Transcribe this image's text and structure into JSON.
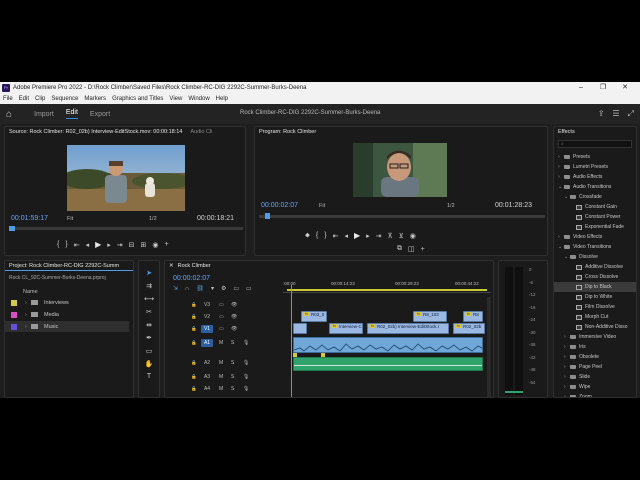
{
  "titlebar": {
    "logo_text": "Pr",
    "title": "Adobe Premiere Pro 2022 - D:\\Rock Climber\\Saved Files\\Rock Climber-RC-DIG 2292C-Summer-Burks-Deena",
    "minimize": "–",
    "restore": "❐",
    "close": "✕"
  },
  "menubar": [
    "File",
    "Edit",
    "Clip",
    "Sequence",
    "Markers",
    "Graphics and Titles",
    "View",
    "Window",
    "Help"
  ],
  "workspaces": {
    "home_icon": "home-icon",
    "items": [
      "Import",
      "Edit",
      "Export"
    ],
    "active": "Edit",
    "project_title": "Rock Climber-RC-DIG 2292C-Summer-Burks-Deena"
  },
  "source": {
    "tab_label": "Source: Rock Climber: R02_02b) Interview-EditStock.mov: 00:00:18:14",
    "tab2": "Audio Cli",
    "timecode_in": "00:01:59:17",
    "timecode_dur": "00:00:18:21",
    "fit": "Fit",
    "resolution": "1/2"
  },
  "program": {
    "tab_label": "Program: Rock Climber",
    "timecode_in": "00:00:02:07",
    "timecode_dur": "00:01:28:23",
    "fit": "Fit",
    "resolution": "1/2"
  },
  "project": {
    "tab_label": "Project: Rock Climber-RC-DIG 2292C-Summ",
    "file_path": "Rock CL_92C-Summer-Burks-Deena.prproj",
    "column_name": "Name",
    "items": [
      {
        "label": "Interviews",
        "color": "#d4c94a"
      },
      {
        "label": "Media",
        "color": "#d64fc4"
      },
      {
        "label": "Music",
        "color": "#6a4fd6"
      }
    ]
  },
  "timeline": {
    "tab_label": "Rock Climber",
    "timecode": "00:00:02:07",
    "ruler": [
      ":00:00",
      "00:00:14:23",
      "00:00:29:23",
      "00:00:44:22"
    ],
    "video_tracks": [
      "V3",
      "V2",
      "V1"
    ],
    "audio_tracks": [
      "A1",
      "A2",
      "A3",
      "A4"
    ],
    "mix_label": "Mix",
    "mix_value": "0.0",
    "clips": {
      "v2_a": "R03_0",
      "v2_b": "R8_103",
      "v2_c": "R8",
      "v1_a": "Interview-C",
      "v1_b": "R02_02b) Interview-EditStock.r",
      "v1_c": "R02_02b"
    }
  },
  "meters": {
    "scale": [
      "0",
      "-6",
      "-12",
      "-18",
      "-24",
      "-30",
      "-36",
      "-42",
      "-48",
      "-54"
    ]
  },
  "effects": {
    "tab_label": "Effects",
    "items": [
      {
        "label": "Presets",
        "level": 0,
        "type": "folder"
      },
      {
        "label": "Lumetri Presets",
        "level": 0,
        "type": "folder"
      },
      {
        "label": "Audio Effects",
        "level": 0,
        "type": "folder"
      },
      {
        "label": "Audio Transitions",
        "level": 0,
        "type": "folder-open"
      },
      {
        "label": "Crossfade",
        "level": 1,
        "type": "folder-open"
      },
      {
        "label": "Constant Gain",
        "level": 2,
        "type": "fx"
      },
      {
        "label": "Constant Power",
        "level": 2,
        "type": "fx"
      },
      {
        "label": "Exponential Fade",
        "level": 2,
        "type": "fx"
      },
      {
        "label": "Video Effects",
        "level": 0,
        "type": "folder"
      },
      {
        "label": "Video Transitions",
        "level": 0,
        "type": "folder-open"
      },
      {
        "label": "Dissolve",
        "level": 1,
        "type": "folder-open"
      },
      {
        "label": "Additive Dissolve",
        "level": 2,
        "type": "fx"
      },
      {
        "label": "Cross Dissolve",
        "level": 2,
        "type": "fx"
      },
      {
        "label": "Dip to Black",
        "level": 2,
        "type": "fx",
        "selected": true
      },
      {
        "label": "Dip to White",
        "level": 2,
        "type": "fx"
      },
      {
        "label": "Film Dissolve",
        "level": 2,
        "type": "fx"
      },
      {
        "label": "Morph Cut",
        "level": 2,
        "type": "fx"
      },
      {
        "label": "Non-Additive Disso",
        "level": 2,
        "type": "fx"
      },
      {
        "label": "Immersive Video",
        "level": 1,
        "type": "folder"
      },
      {
        "label": "Iris",
        "level": 1,
        "type": "folder"
      },
      {
        "label": "Obsolete",
        "level": 1,
        "type": "folder"
      },
      {
        "label": "Page Peel",
        "level": 1,
        "type": "folder"
      },
      {
        "label": "Slide",
        "level": 1,
        "type": "folder"
      },
      {
        "label": "Wipe",
        "level": 1,
        "type": "folder"
      },
      {
        "label": "Zoom",
        "level": 1,
        "type": "folder"
      }
    ]
  }
}
